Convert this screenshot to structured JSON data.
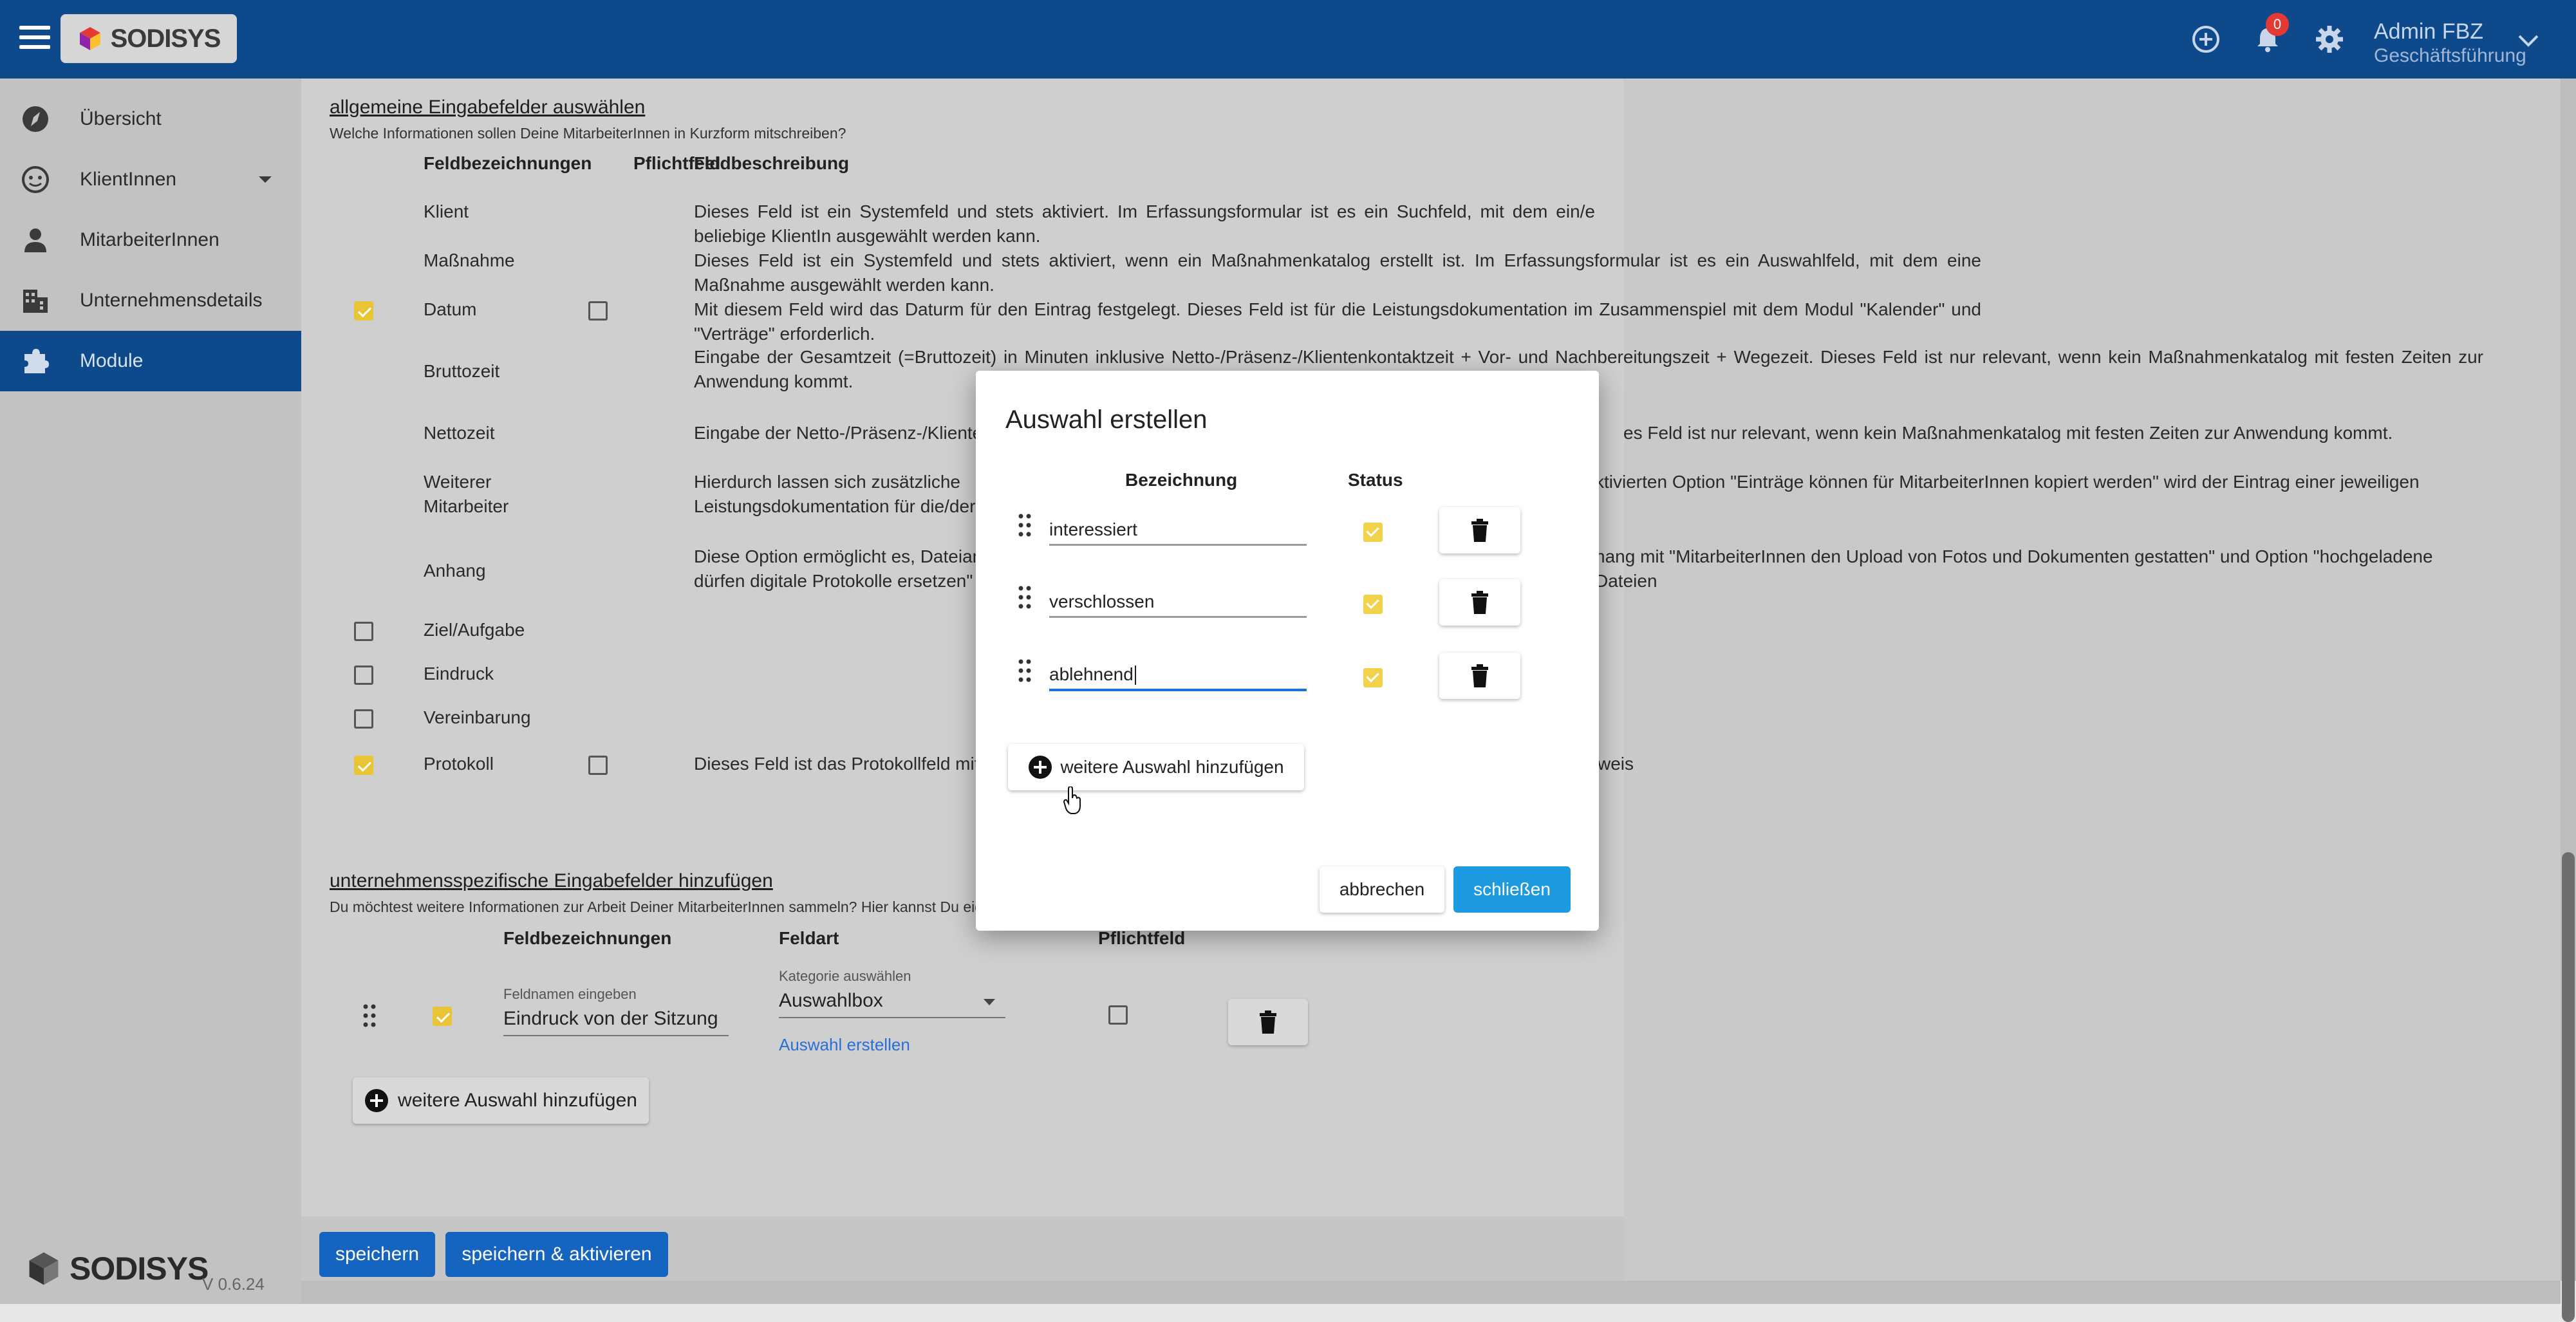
{
  "header": {
    "logo_text": "SODISYS",
    "notification_count": "0",
    "user_name": "Admin FBZ",
    "user_role": "Geschäftsführung"
  },
  "sidebar": {
    "items": [
      {
        "label": "Übersicht",
        "icon": "compass-icon"
      },
      {
        "label": "KlientInnen",
        "icon": "face-icon"
      },
      {
        "label": "MitarbeiterInnen",
        "icon": "person-icon"
      },
      {
        "label": "Unternehmensdetails",
        "icon": "building-icon"
      },
      {
        "label": "Module",
        "icon": "puzzle-icon"
      }
    ],
    "footer_logo": "SODISYS",
    "version": "V 0.6.24"
  },
  "section1": {
    "title": "allgemeine Eingabefelder auswählen",
    "subtitle": "Welche Informationen sollen Deine MitarbeiterInnen in Kurzform mitschreiben?",
    "col_name": "Feldbezeichnungen",
    "col_required": "Pflichtfeld",
    "col_desc": "Feldbeschreibung",
    "rows": [
      {
        "name": "Klient",
        "desc": "Dieses Feld ist ein Systemfeld und stets aktiviert. Im Erfassungsformular ist es ein Suchfeld, mit dem ein/e beliebige KlientIn ausgewählt werden kann."
      },
      {
        "name": "Maßnahme",
        "desc": "Dieses Feld ist ein Systemfeld und stets aktiviert, wenn ein Maßnahmenkatalog erstellt ist. Im Erfassungsformular ist es ein Auswahlfeld, mit dem eine Maßnahme ausgewählt werden kann."
      },
      {
        "name": "Datum",
        "desc": "Mit diesem Feld wird das Daturm für den Eintrag festgelegt. Dieses Feld ist für die Leistungsdokumentation im Zusammenspiel mit dem Modul \"Kalender\" und \"Verträge\" erforderlich."
      },
      {
        "name": "Bruttozeit",
        "desc": "Eingabe der Gesamtzeit (=Bruttozeit) in Minuten inklusive Netto-/Präsenz-/Klientenkontaktzeit + Vor- und Nachbereitungszeit + Wegezeit. Dieses Feld ist nur relevant, wenn kein Maßnahmenkatalog mit festen Zeiten zur Anwendung kommt."
      },
      {
        "name": "Nettozeit",
        "desc_left": "Eingabe der Netto-/Präsenz-/Kliente",
        "desc_right": "es Feld ist nur relevant, wenn kein Maßnahmenkatalog mit festen Zeiten zur Anwendung kommt."
      },
      {
        "name": "Weiterer Mitarbeiter",
        "desc_left": "Hierdurch lassen sich zusätzliche",
        "desc_left2": "Leistungsdokumentation für die/der",
        "desc_right": "ktivierten Option \"Einträge können für MitarbeiterInnen kopiert werden\" wird der Eintrag einer jeweiligen"
      },
      {
        "name": "Anhang",
        "desc_left": "Diese Option ermöglicht es, Dateian",
        "desc_left2": "dürfen digitale Protokolle ersetzen\" e",
        "desc_right": "hang mit \"MitarbeiterInnen den Upload von Fotos und Dokumenten gestatten\" und Option \"hochgeladene Dateien"
      },
      {
        "name": "Ziel/Aufgabe"
      },
      {
        "name": "Eindruck"
      },
      {
        "name": "Vereinbarung"
      },
      {
        "name": "Protokoll",
        "desc_left": "Dieses Feld ist das Protokollfeld mit",
        "desc_right": "weis"
      }
    ]
  },
  "section2": {
    "title": "unternehmensspezifische Eingabefelder hinzufügen",
    "subtitle": "Du möchtest weitere Informationen zur Arbeit Deiner MitarbeiterInnen sammeln? Hier kannst Du eig",
    "col_name": "Feldbezeichnungen",
    "col_type": "Feldart",
    "col_required": "Pflichtfeld",
    "field_label": "Feldnamen eingeben",
    "field_value": "Eindruck von der Sitzung",
    "category_label": "Kategorie auswählen",
    "category_value": "Auswahlbox",
    "create_link": "Auswahl erstellen",
    "add_button": "weitere Auswahl hinzufügen"
  },
  "footer": {
    "save": "speichern",
    "save_activate": "speichern & aktivieren"
  },
  "modal": {
    "title": "Auswahl erstellen",
    "col_name": "Bezeichnung",
    "col_status": "Status",
    "options": [
      {
        "value": "interessiert"
      },
      {
        "value": "verschlossen"
      },
      {
        "value": "ablehnend"
      }
    ],
    "add_button": "weitere Auswahl hinzufügen",
    "cancel": "abbrechen",
    "close": "schließen"
  },
  "colors": {
    "brand": "#0e4a8b",
    "accent": "#1e9be0",
    "checkbox": "#e8c534"
  }
}
